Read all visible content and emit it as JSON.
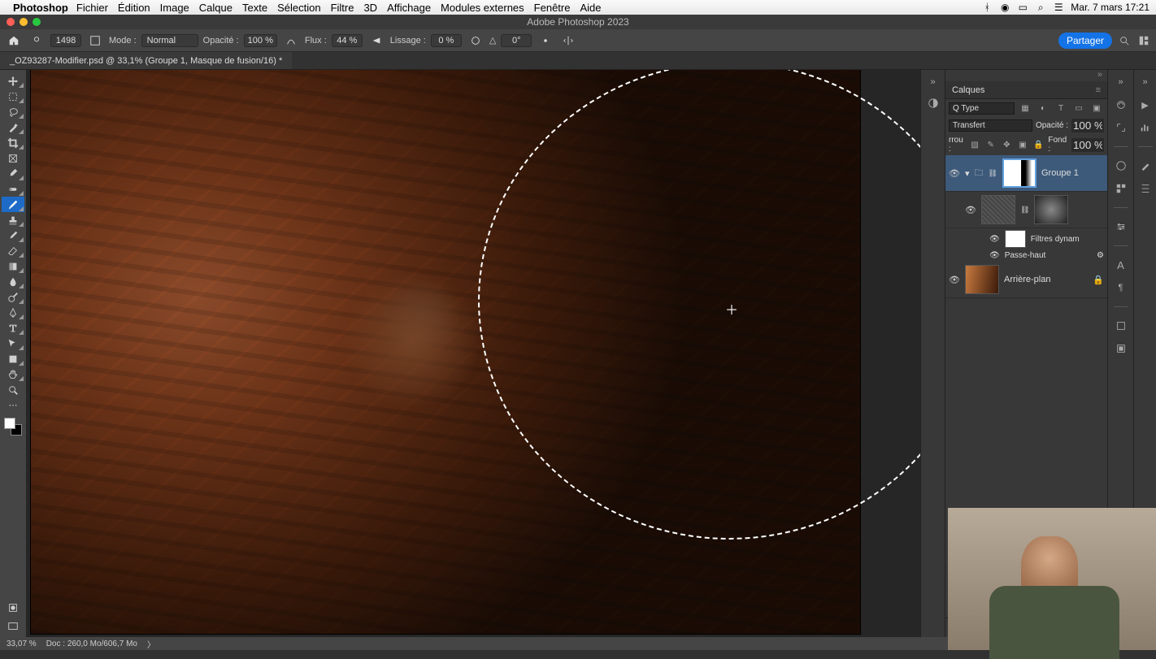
{
  "menubar": {
    "app": "Photoshop",
    "items": [
      "Fichier",
      "Édition",
      "Image",
      "Calque",
      "Texte",
      "Sélection",
      "Filtre",
      "3D",
      "Affichage",
      "Modules externes",
      "Fenêtre",
      "Aide"
    ],
    "clock": "Mar. 7 mars  17:21"
  },
  "window": {
    "title": "Adobe Photoshop 2023"
  },
  "options": {
    "brush_size": "1498",
    "mode_label": "Mode :",
    "mode_value": "Normal",
    "opacity_label": "Opacité :",
    "opacity_value": "100 %",
    "flux_label": "Flux :",
    "flux_value": "44 %",
    "smoothing_label": "Lissage :",
    "smoothing_value": "0 %",
    "angle_label": "△",
    "angle_value": "0°",
    "share": "Partager"
  },
  "tab": {
    "title": "_OZ93287-Modifier.psd @ 33,1% (Groupe 1, Masque de fusion/16) *"
  },
  "tools": [
    "move",
    "marquee",
    "lasso",
    "wand",
    "crop",
    "frame",
    "eyedropper",
    "heal",
    "brush",
    "stamp",
    "history",
    "eraser",
    "gradient",
    "blur",
    "dodge",
    "pen",
    "type",
    "path",
    "rect",
    "hand",
    "zoom"
  ],
  "active_tool": "brush",
  "panels": {
    "layers_title": "Calques",
    "kind_label": "Q Type",
    "blend_value": "Transfert",
    "opacity_label": "Opacité :",
    "opacity_value": "100 %",
    "lock_label": "rrou :",
    "fill_label": "Fond :",
    "fill_value": "100 %",
    "layer_group": "Groupe 1",
    "smart_filters": "Filtres dynam",
    "high_pass": "Passe-haut",
    "background": "Arrière-plan"
  },
  "status": {
    "zoom": "33,07 %",
    "doc": "Doc : 260,0 Mo/606,7 Mo"
  }
}
